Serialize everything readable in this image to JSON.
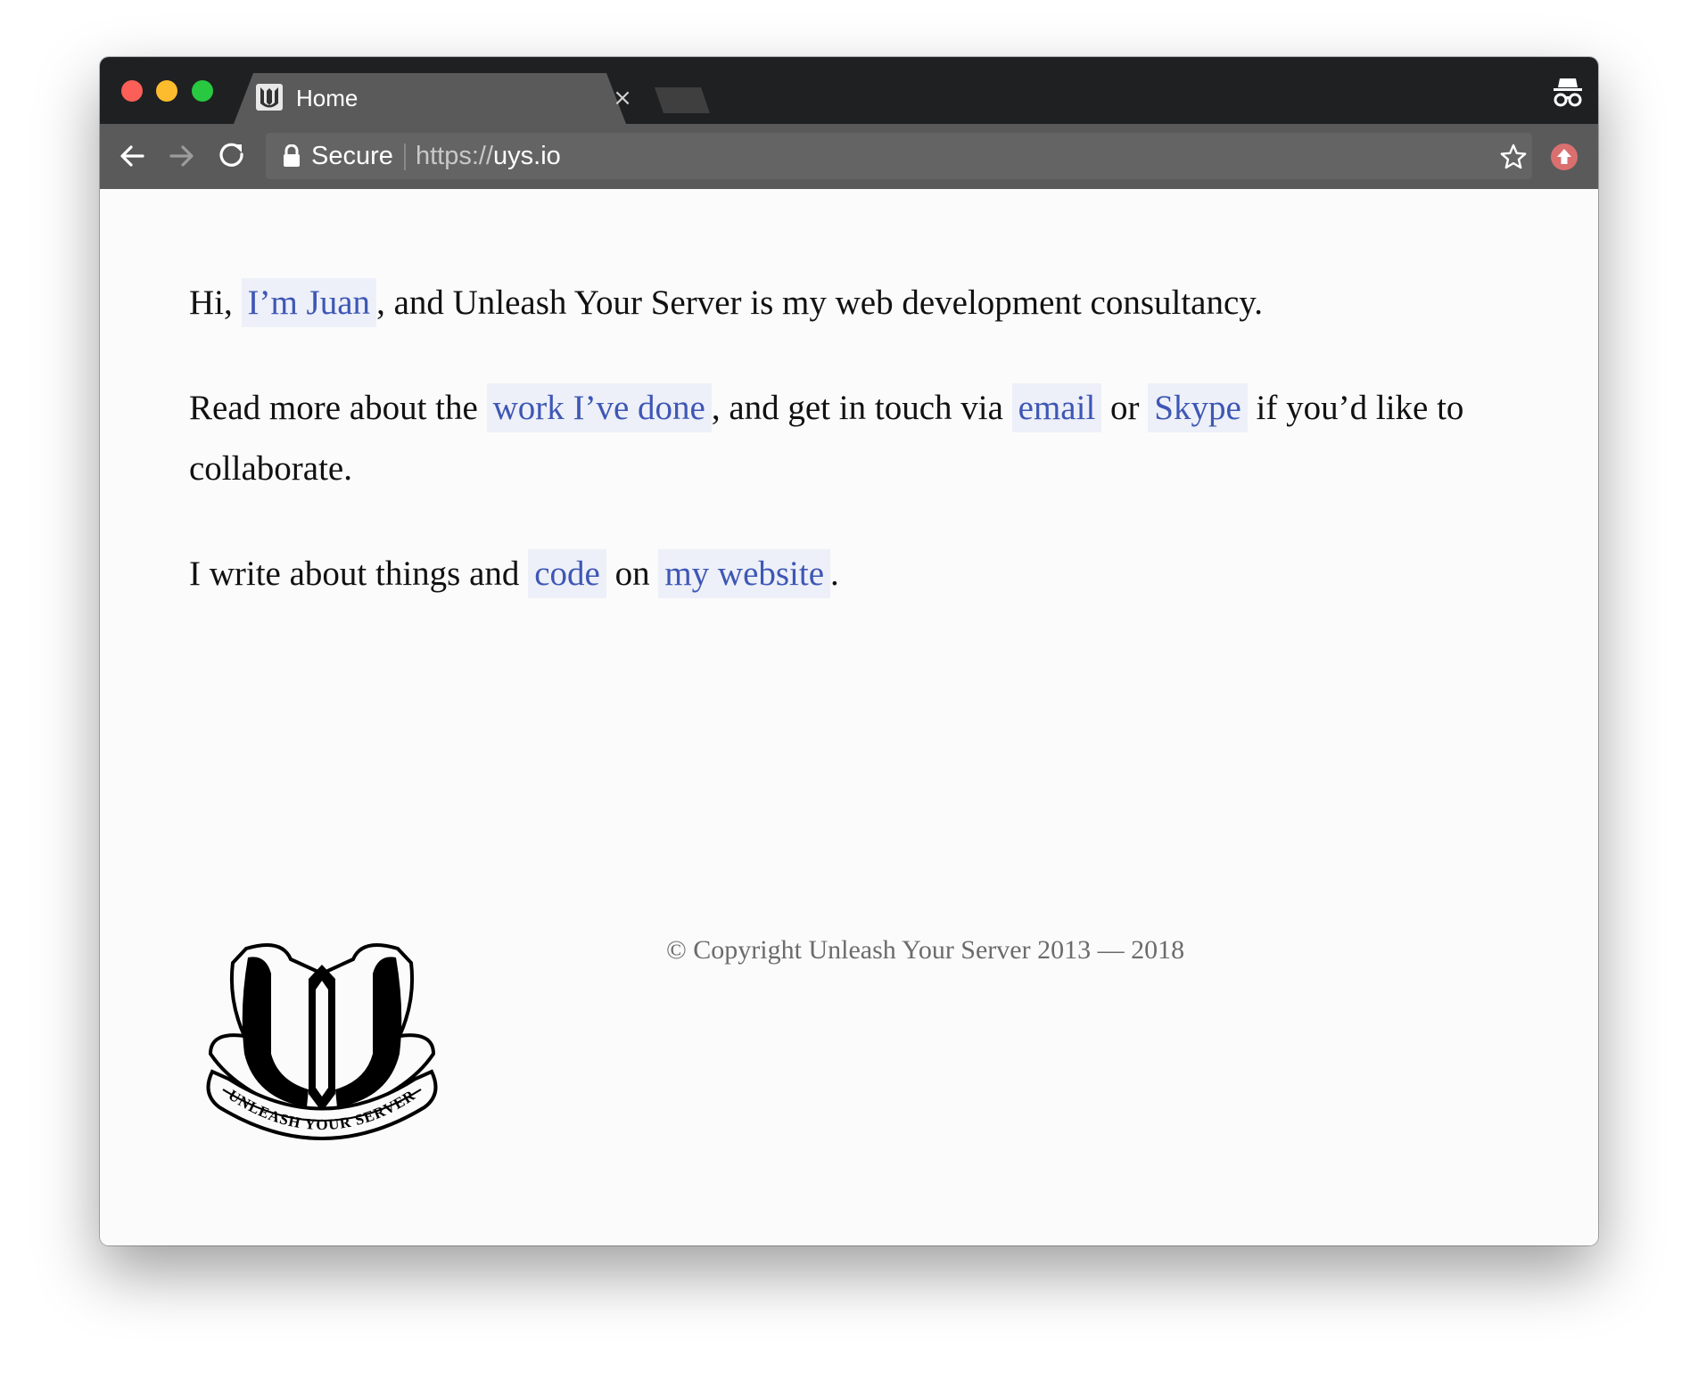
{
  "browser": {
    "tab_title": "Home",
    "tab_close": "×",
    "secure_label": "Secure",
    "url_scheme": "https://",
    "url_host": "uys.io",
    "icons": [
      "back-icon",
      "forward-icon",
      "reload-icon",
      "lock-icon",
      "star-icon",
      "extension-icon",
      "incognito-icon",
      "favicon"
    ]
  },
  "content": {
    "p1": {
      "before": "Hi,",
      "link": "I’m Juan",
      "after": ", and Unleash Your Server is my web development consultancy."
    },
    "p2": {
      "before": "Read more about the",
      "link1": "work I’ve done",
      "mid1": ", and get in touch via",
      "link2": "email",
      "mid2": "or",
      "link3": "Skype",
      "after": "if you’d like to collaborate."
    },
    "p3": {
      "before": "I write about things and",
      "link1": "code",
      "mid": "on",
      "link2": "my website",
      "after": "."
    }
  },
  "footer": {
    "copyright": "© Copyright Unleash Your Server 2013 — 2018",
    "logo_text": "UNLEASH YOUR SERVER"
  },
  "colors": {
    "link": "#3e57b5",
    "link_bg": "#edf0f8",
    "titlebar": "#1f2022",
    "toolbar": "#5a5a5b"
  }
}
